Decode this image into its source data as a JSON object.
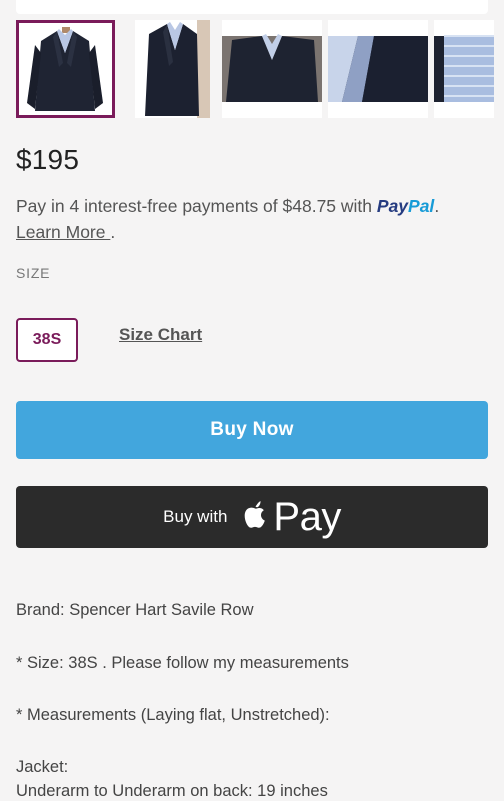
{
  "gallery": {
    "thumbnails": [
      {
        "name": "jacket-front-thumbnail",
        "selected": true
      },
      {
        "name": "jacket-side-thumbnail",
        "selected": false
      },
      {
        "name": "jacket-closeup-thumbnail",
        "selected": false
      },
      {
        "name": "fabric-detail-thumbnail",
        "selected": false
      },
      {
        "name": "lining-detail-thumbnail",
        "selected": false
      }
    ]
  },
  "product": {
    "price": "$195"
  },
  "paypal": {
    "text": "Pay in 4 interest-free payments of $48.75 with ",
    "logo_pay": "Pay",
    "logo_pal": "Pal",
    "period": ".",
    "learn_more": "Learn More ",
    "learn_more_suffix": "."
  },
  "size": {
    "label": "SIZE",
    "selected": "38S",
    "chart_link": "Size Chart"
  },
  "buttons": {
    "buy_now": "Buy Now",
    "apple_pay_prefix": "Buy with",
    "apple_pay_word": "Pay"
  },
  "description": {
    "lines": [
      "Brand: Spencer Hart Savile Row",
      "* Size: 38S . Please follow my measurements",
      "* Measurements (Laying flat, Unstretched):",
      "Jacket:",
      "Underarm to Underarm on back: 19 inches"
    ]
  },
  "colors": {
    "accent": "#7a1b5a",
    "buy_now": "#42a6dd",
    "apple_pay": "#2b2b2b",
    "background": "#f5f4f4"
  }
}
